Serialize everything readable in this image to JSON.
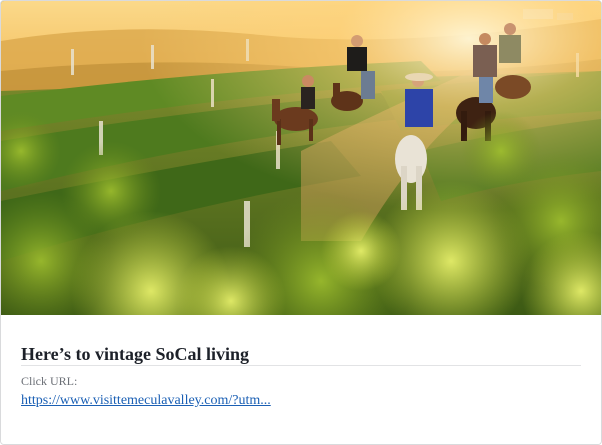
{
  "post": {
    "headline": "Here’s to vintage SoCal living",
    "url_label": "Click URL:",
    "url_text": "https://www.visittemeculavalley.com/?utm...",
    "image": {
      "subject": "horseback-riders-in-vineyard",
      "palette": {
        "sky": "#f6c25a",
        "haze": "#f1a945",
        "vines": "#4f7a22",
        "vines_dark": "#2e4a12",
        "foreground": "#b7c93c"
      }
    }
  }
}
